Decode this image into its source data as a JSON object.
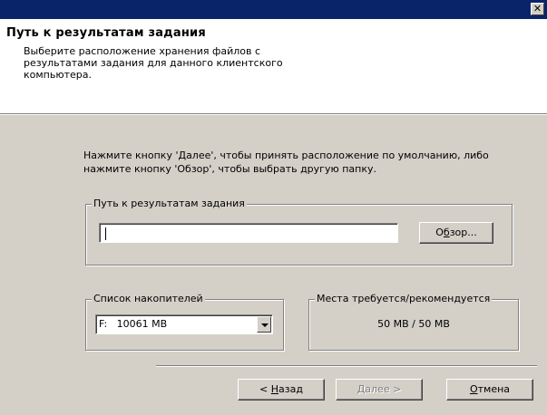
{
  "window": {
    "close_glyph": "✕"
  },
  "header": {
    "title": "Путь к результатам задания",
    "description": "Выберите расположение хранения файлов с результатами задания для данного клиентского компьютера."
  },
  "intro": {
    "text": "Нажмите кнопку 'Далее', чтобы принять расположение по умолчанию, либо нажмите кнопку 'Обзор', чтобы выбрать другую папку."
  },
  "path_group": {
    "label": "Путь к результатам задания",
    "value": "",
    "browse_prefix": "О",
    "browse_accel": "б",
    "browse_suffix": "зор..."
  },
  "drive_group": {
    "label": "Список накопителей",
    "selected": "F:   10061 MB"
  },
  "space_group": {
    "label": "Места требуется/рекомендуется",
    "value": "50 MB / 50 MB"
  },
  "buttons": {
    "back_prefix": "< ",
    "back_accel": "Н",
    "back_suffix": "азад",
    "next_accel": "Д",
    "next_suffix": "алее >",
    "cancel_accel": "О",
    "cancel_suffix": "тмена"
  }
}
